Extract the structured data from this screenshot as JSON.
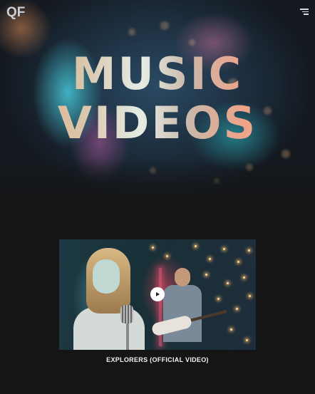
{
  "header": {
    "logo_text": "QF",
    "menu_icon": "hamburger-menu-icon"
  },
  "hero": {
    "title_line1": "MUSIC",
    "title_line2": "VIDEOS"
  },
  "videos": [
    {
      "title": "EXPLORERS (OFFICIAL VIDEO)",
      "play_icon": "play-icon"
    }
  ],
  "colors": {
    "background": "#151515",
    "title_gradient": [
      "#f3a88a",
      "#e4ece4",
      "#f0a287"
    ],
    "video_title": "#f2f2f2"
  }
}
